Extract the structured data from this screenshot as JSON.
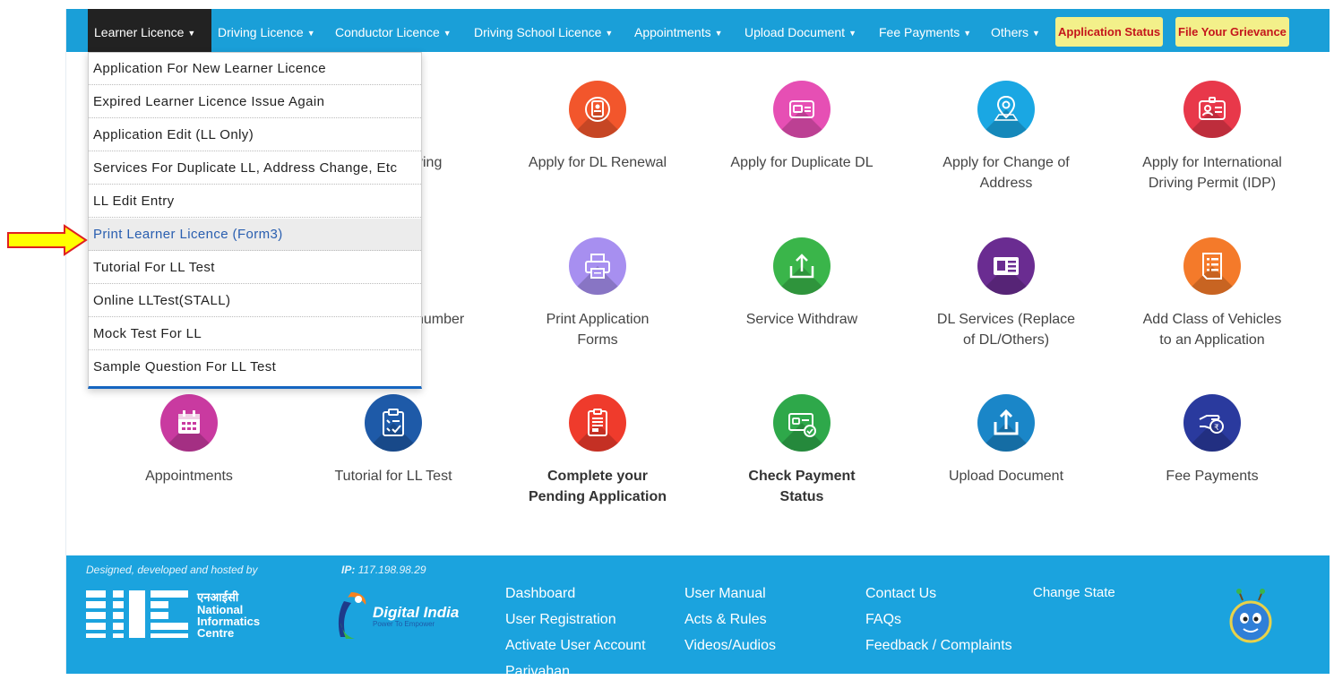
{
  "nav": {
    "items": [
      "Learner Licence",
      "Driving Licence",
      "Conductor Licence",
      "Driving School Licence",
      "Appointments",
      "Upload Document",
      "Fee Payments",
      "Others"
    ],
    "pills": [
      "Application Status",
      "File Your Grievance"
    ]
  },
  "dropdown": {
    "items": [
      "Application For New Learner Licence",
      "Expired Learner Licence Issue Again",
      "Application Edit (LL Only)",
      "Services For Duplicate LL, Address Change, Etc",
      "LL Edit Entry",
      "Print Learner Licence (Form3)",
      "Tutorial For LL Test",
      "Online LLTest(STALL)",
      "Mock Test For LL",
      "Sample Question For LL Test"
    ],
    "highlighted": "Print Learner Licence (Form3)"
  },
  "tiles": {
    "row1": {
      "partial": "ving",
      "items": [
        {
          "line1": "Apply for DL Renewal",
          "line2": "",
          "color": "#f2562c",
          "icon": "license-renewal-icon"
        },
        {
          "line1": "Apply for Duplicate DL",
          "line2": "",
          "color": "#e64fb4",
          "icon": "duplicate-card-icon"
        },
        {
          "line1": "Apply for Change of",
          "line2": "Address",
          "color": "#1aa7e3",
          "icon": "location-pin-icon"
        },
        {
          "line1": "Apply for International",
          "line2": "Driving Permit (IDP)",
          "color": "#e8384a",
          "icon": "id-badge-icon"
        }
      ]
    },
    "row2": {
      "partial": "number",
      "items": [
        {
          "line1": "Print Application",
          "line2": "Forms",
          "color": "#a78ff0",
          "icon": "printer-icon"
        },
        {
          "line1": "Service Withdraw",
          "line2": "",
          "color": "#3ab54a",
          "icon": "tray-upload-icon"
        },
        {
          "line1": "DL Services (Replace",
          "line2": "of DL/Others)",
          "color": "#6a2c91",
          "icon": "id-card-icon"
        },
        {
          "line1": "Add Class of Vehicles",
          "line2": "to an Application",
          "color": "#f47a2a",
          "icon": "document-list-icon"
        }
      ]
    },
    "row3": [
      {
        "line1": "Appointments",
        "line2": "",
        "color": "#c93aa0",
        "icon": "calendar-icon",
        "bold": false
      },
      {
        "line1": "Tutorial for LL Test",
        "line2": "",
        "color": "#1e5aa8",
        "icon": "checklist-icon",
        "bold": false
      },
      {
        "line1": "Complete your",
        "line2": "Pending Application",
        "color": "#ef3b2c",
        "icon": "form-document-icon",
        "bold": true
      },
      {
        "line1": "Check Payment",
        "line2": "Status",
        "color": "#2ea84a",
        "icon": "payment-card-icon",
        "bold": true
      },
      {
        "line1": "Upload Document",
        "line2": "",
        "color": "#1a86c8",
        "icon": "upload-tray-icon",
        "bold": false
      },
      {
        "line1": "Fee Payments",
        "line2": "",
        "color": "#2a3a9e",
        "icon": "hand-coin-icon",
        "bold": false
      }
    ]
  },
  "footer": {
    "credit": "Designed, developed and hosted by",
    "ip_label": "IP:",
    "ip_value": "117.198.98.29",
    "nic_hindi": "एनआईसी",
    "nic_name1": "National",
    "nic_name2": "Informatics",
    "nic_name3": "Centre",
    "di_name": "Digital India",
    "di_tag": "Power To Empower",
    "links_col1": [
      "Dashboard",
      "User Registration",
      "Activate User Account",
      "Parivahan"
    ],
    "links_col2": [
      "User Manual",
      "Acts & Rules",
      "Videos/Audios"
    ],
    "links_col3": [
      "Contact Us",
      "FAQs",
      "Feedback / Complaints"
    ],
    "change_state": "Change State"
  }
}
